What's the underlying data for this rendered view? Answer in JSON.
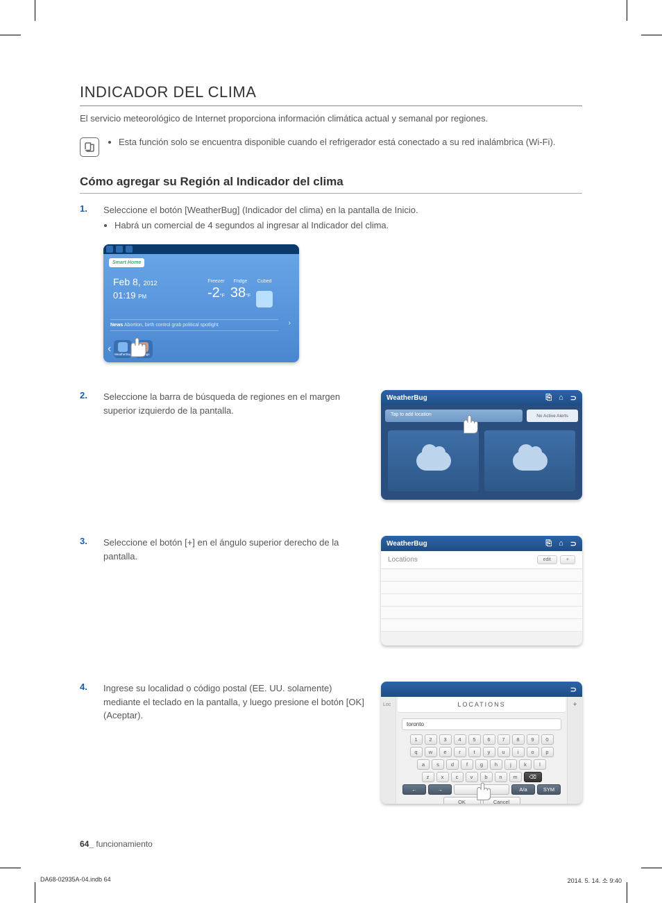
{
  "section_title": "INDICADOR DEL CLIMA",
  "intro": "El servicio meteorológico de Internet proporciona información climática actual y semanal por regiones.",
  "note": "Esta función solo se encuentra disponible cuando el refrigerador está conectado a su red inalámbrica (Wi-Fi).",
  "subtitle": "Cómo agregar su Región al Indicador del clima",
  "steps": {
    "s1_num": "1.",
    "s1_text": "Seleccione el botón [WeatherBug] (Indicador del clima) en la pantalla de Inicio.",
    "s1_bullet": "Habrá un comercial de 4 segundos al ingresar al Indicador del clima.",
    "s2_num": "2.",
    "s2_text": "Seleccione la barra de búsqueda de regiones en el margen superior izquierdo de la pantalla.",
    "s3_num": "3.",
    "s3_text": "Seleccione el botón [+] en el ángulo superior derecho de la pantalla.",
    "s4_num": "4.",
    "s4_text": "Ingrese su localidad o código postal (EE. UU. solamente) mediante el teclado en la pantalla, y luego presione el botón [OK] (Aceptar)."
  },
  "fig1": {
    "tag": "Smart Home",
    "date_main": "Feb 8,",
    "date_year": "2012",
    "time": "01:19",
    "time_suffix": "PM",
    "freezer_label": "Freezer",
    "freezer_val": "-2",
    "freezer_unit": "°F",
    "fridge_label": "Fridge",
    "fridge_val": "38",
    "fridge_unit": "°F",
    "cubed_label": "Cubed",
    "news_prefix": "News",
    "news_text": "Abortion, birth control grab political spotlight",
    "app1": "WeatherBug",
    "app2": "Settings"
  },
  "fig_header": {
    "brand": "WeatherBug",
    "icon_save": "⎘",
    "icon_home": "⌂",
    "icon_back": "⊃"
  },
  "fig2": {
    "search_placeholder": "Tap to add location",
    "alerts": "No Active Alerts"
  },
  "fig3": {
    "sub_label": "Locations",
    "edit_btn": "edit",
    "plus_btn": "+"
  },
  "fig4": {
    "title": "LOCATIONS",
    "side_label": "Loc",
    "plus": "+",
    "input_value": "toronto",
    "row_nums": [
      "1",
      "2",
      "3",
      "4",
      "5",
      "6",
      "7",
      "8",
      "9",
      "0"
    ],
    "row_q": [
      "q",
      "w",
      "e",
      "r",
      "t",
      "y",
      "u",
      "i",
      "o",
      "p"
    ],
    "row_a": [
      "a",
      "s",
      "d",
      "f",
      "g",
      "h",
      "j",
      "k",
      "l"
    ],
    "row_z": [
      "z",
      "x",
      "c",
      "v",
      "b",
      "n",
      "m"
    ],
    "backspace": "⌫",
    "arrow_left": "←",
    "arrow_right": "→",
    "shift": "A/a",
    "sym": "SYM",
    "ok": "OK",
    "cancel": "Cancel"
  },
  "footer_page": "64_",
  "footer_label": "funcionamiento",
  "print_left": "DA68-02935A-04.indb   64",
  "print_right": "2014. 5. 14.   소 9:40"
}
